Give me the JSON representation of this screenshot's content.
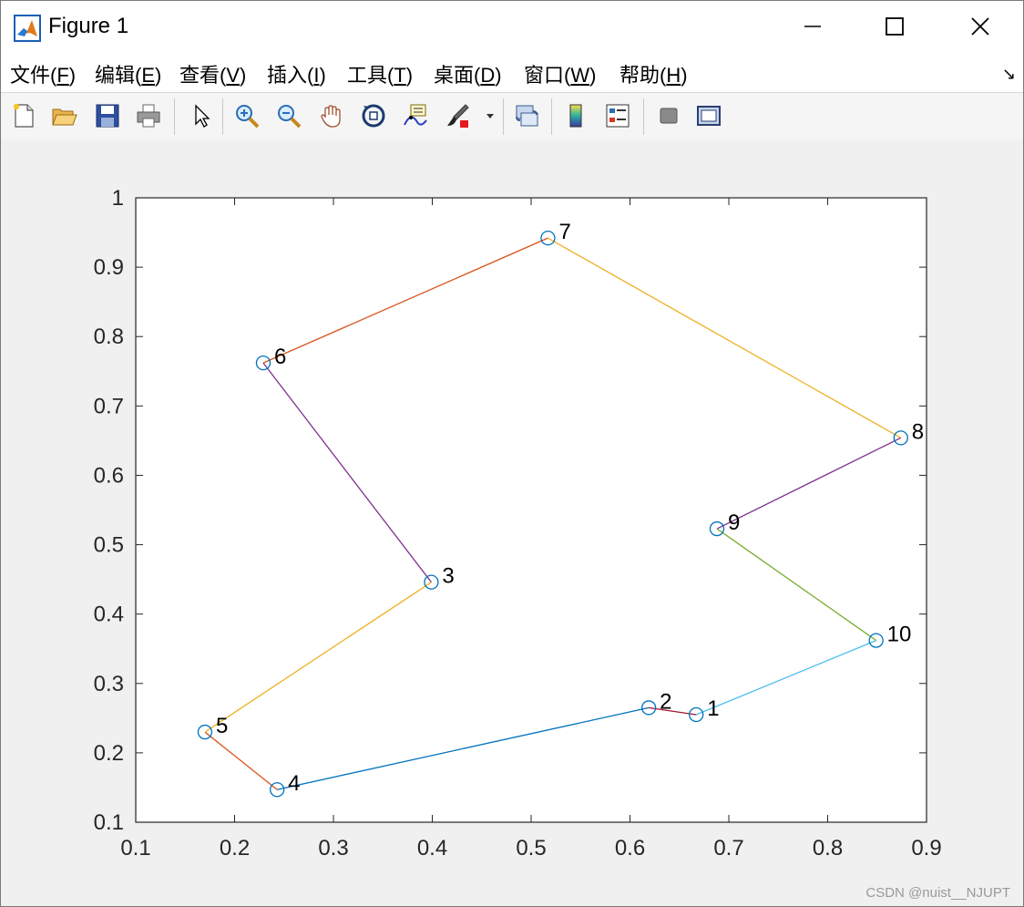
{
  "window": {
    "title": "Figure 1",
    "buttons": {
      "minimize": "minimize-icon",
      "maximize": "maximize-icon",
      "close": "close-icon"
    }
  },
  "menu": {
    "items": [
      {
        "label": "文件(",
        "key": "F",
        "tail": ")"
      },
      {
        "label": "编辑(",
        "key": "E",
        "tail": ")"
      },
      {
        "label": "查看(",
        "key": "V",
        "tail": ")"
      },
      {
        "label": "插入(",
        "key": "I",
        "tail": ")"
      },
      {
        "label": "工具(",
        "key": "T",
        "tail": ")"
      },
      {
        "label": "桌面(",
        "key": "D",
        "tail": ")"
      },
      {
        "label": "窗口(",
        "key": "W",
        "tail": ")"
      },
      {
        "label": "帮助(",
        "key": "H",
        "tail": ")"
      }
    ],
    "dock_arrow": "↘"
  },
  "toolbar": {
    "icons": [
      "new-figure-icon",
      "open-file-icon",
      "save-icon",
      "print-icon",
      "edit-plot-arrow-icon",
      "zoom-in-icon",
      "zoom-out-icon",
      "pan-hand-icon",
      "rotate-3d-icon",
      "data-cursor-icon",
      "brush-icon",
      "link-plot-icon",
      "colorbar-icon",
      "legend-icon",
      "hide-plot-tools-icon",
      "show-plot-tools-icon"
    ]
  },
  "chart_data": {
    "type": "line",
    "xlim": [
      0.1,
      0.9
    ],
    "ylim": [
      0.1,
      1.0
    ],
    "xticks": [
      "0.1",
      "0.2",
      "0.3",
      "0.4",
      "0.5",
      "0.6",
      "0.7",
      "0.8",
      "0.9"
    ],
    "yticks": [
      "0.1",
      "0.2",
      "0.3",
      "0.4",
      "0.5",
      "0.6",
      "0.7",
      "0.8",
      "0.9",
      "1"
    ],
    "points": [
      {
        "label": "1",
        "x": 0.667,
        "y": 0.255
      },
      {
        "label": "2",
        "x": 0.619,
        "y": 0.265
      },
      {
        "label": "3",
        "x": 0.399,
        "y": 0.446
      },
      {
        "label": "4",
        "x": 0.243,
        "y": 0.147
      },
      {
        "label": "5",
        "x": 0.17,
        "y": 0.23
      },
      {
        "label": "6",
        "x": 0.229,
        "y": 0.762
      },
      {
        "label": "7",
        "x": 0.517,
        "y": 0.942
      },
      {
        "label": "8",
        "x": 0.874,
        "y": 0.654
      },
      {
        "label": "9",
        "x": 0.688,
        "y": 0.523
      },
      {
        "label": "10",
        "x": 0.849,
        "y": 0.362
      }
    ],
    "segments": [
      {
        "from": 10,
        "to": 1,
        "color": "#4DBEEE"
      },
      {
        "from": 1,
        "to": 2,
        "color": "#A2142F"
      },
      {
        "from": 2,
        "to": 4,
        "color": "#0072BD"
      },
      {
        "from": 4,
        "to": 5,
        "color": "#D95319"
      },
      {
        "from": 5,
        "to": 3,
        "color": "#EDB120"
      },
      {
        "from": 3,
        "to": 6,
        "color": "#7E2F8E"
      },
      {
        "from": 6,
        "to": 7,
        "color": "#D95319"
      },
      {
        "from": 7,
        "to": 8,
        "color": "#EDB120"
      },
      {
        "from": 8,
        "to": 9,
        "color": "#7E2F8E"
      },
      {
        "from": 9,
        "to": 10,
        "color": "#77AC30"
      }
    ],
    "marker": "circle",
    "marker_color": "#0072BD",
    "grid": false
  },
  "watermark": "CSDN @nuist__NJUPT"
}
